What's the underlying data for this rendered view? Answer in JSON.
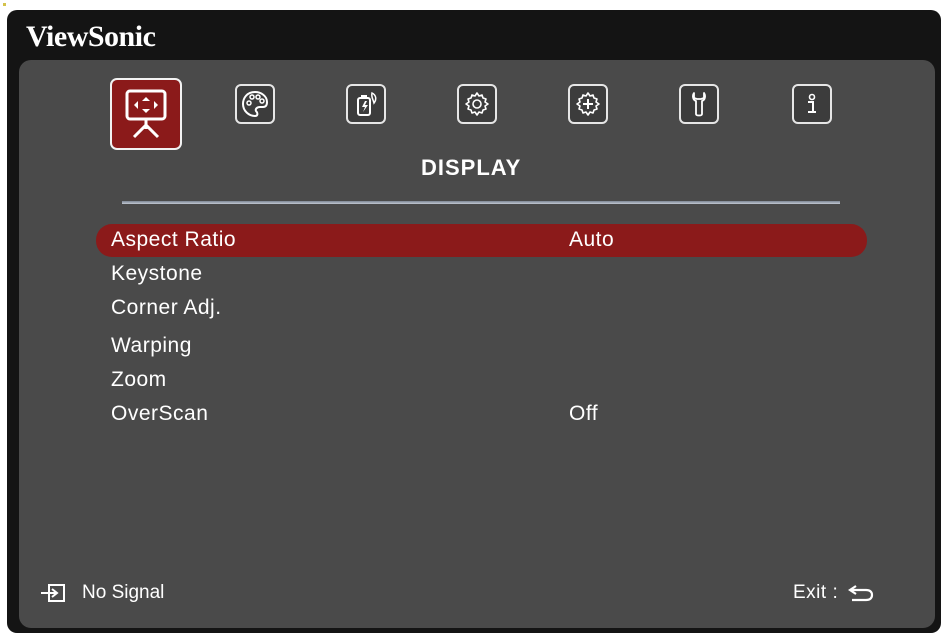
{
  "brand": "ViewSonic",
  "tabs": [
    {
      "id": "display",
      "icon": "display-icon",
      "active": true
    },
    {
      "id": "image",
      "icon": "palette-icon",
      "active": false
    },
    {
      "id": "power",
      "icon": "power-management-icon",
      "active": false
    },
    {
      "id": "basic",
      "icon": "gear-icon",
      "active": false
    },
    {
      "id": "advanced",
      "icon": "advanced-gear-icon",
      "active": false
    },
    {
      "id": "system",
      "icon": "wrench-icon",
      "active": false
    },
    {
      "id": "info",
      "icon": "info-icon",
      "active": false
    }
  ],
  "section_title": "DISPLAY",
  "menu": {
    "items": [
      {
        "label": "Aspect Ratio",
        "value": "Auto",
        "selected": true
      },
      {
        "label": "Keystone",
        "value": ""
      },
      {
        "label": "Corner Adj.",
        "value": ""
      },
      {
        "label": "Warping",
        "value": ""
      },
      {
        "label": "Zoom",
        "value": ""
      },
      {
        "label": "OverScan",
        "value": "Off"
      }
    ]
  },
  "footer": {
    "signal_text": "No Signal",
    "exit_text": "Exit :"
  },
  "colors": {
    "accent": "#8b1a1a",
    "panel": "#4a4a4a",
    "frame": "#141414"
  }
}
